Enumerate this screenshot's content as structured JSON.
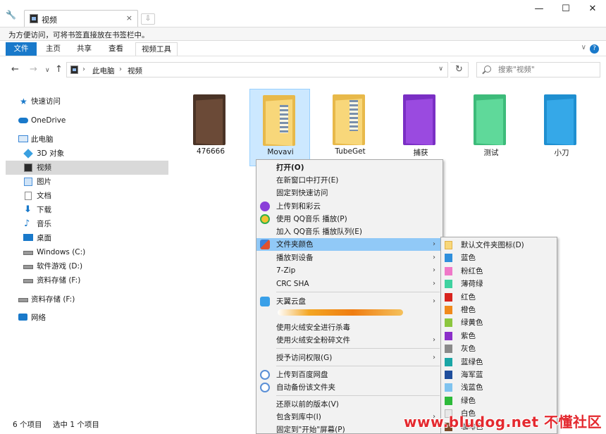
{
  "tab": {
    "title": "视频",
    "close": "×",
    "new_tab": "⇩"
  },
  "window": {
    "minimize": "—",
    "maximize": "☐",
    "close": "✕"
  },
  "bookmark_bar": {
    "hint": "为方便访问，可将书签直接放在书签栏中。"
  },
  "ribbon": {
    "file": "文件",
    "home": "主页",
    "share": "共享",
    "view": "查看",
    "video_tools": "视频工具",
    "expand": "∨",
    "help": "?"
  },
  "address": {
    "crumbs": [
      "此电脑",
      "视频"
    ],
    "sep": "›",
    "dropdown": "∨",
    "refresh": "↻"
  },
  "search": {
    "placeholder": "搜索\"视频\""
  },
  "sidebar": {
    "items": [
      {
        "label": "快速访问",
        "icon": "star-icon",
        "color": "#1979ca"
      },
      {
        "label": "OneDrive",
        "icon": "cloud-icon",
        "color": "#1979ca"
      },
      {
        "label": "此电脑",
        "icon": "computer-icon",
        "color": "#3a86d6"
      },
      {
        "label": "3D 对象",
        "icon": "cube-icon",
        "color": "#3aa0e0"
      },
      {
        "label": "视频",
        "icon": "video-icon",
        "color": "#2b2b2b"
      },
      {
        "label": "图片",
        "icon": "picture-icon",
        "color": "#4a90d9"
      },
      {
        "label": "文档",
        "icon": "document-icon",
        "color": "#8a8a8a"
      },
      {
        "label": "下载",
        "icon": "download-icon",
        "color": "#1979ca"
      },
      {
        "label": "音乐",
        "icon": "music-icon",
        "color": "#1979ca"
      },
      {
        "label": "桌面",
        "icon": "desktop-icon",
        "color": "#1979ca"
      },
      {
        "label": "Windows (C:)",
        "icon": "windows-drive-icon",
        "color": "#6b6b6b"
      },
      {
        "label": "软件游戏 (D:)",
        "icon": "drive-icon",
        "color": "#6b6b6b"
      },
      {
        "label": "资料存储 (F:)",
        "icon": "drive-icon",
        "color": "#6b6b6b"
      },
      {
        "label": "资料存储 (F:)",
        "icon": "drive-icon",
        "color": "#6b6b6b"
      },
      {
        "label": "网络",
        "icon": "network-icon",
        "color": "#1979ca"
      }
    ]
  },
  "files": [
    {
      "name": "476666",
      "back": "#4a3326",
      "front": "#6b4a37"
    },
    {
      "name": "Movavi",
      "back": "#e8b94a",
      "front": "#f8d77a"
    },
    {
      "name": "TubeGet",
      "back": "#e8b94a",
      "front": "#f8d77a"
    },
    {
      "name": "捕获",
      "back": "#7a2fc4",
      "front": "#9a4ae0"
    },
    {
      "name": "测试",
      "back": "#3dbb7a",
      "front": "#5fd99a"
    },
    {
      "name": "小刀",
      "back": "#1f8fd0",
      "front": "#35a8e8"
    }
  ],
  "status": {
    "count": "6 个项目",
    "selected": "选中 1 个项目"
  },
  "context_menu": {
    "items": [
      {
        "label": "打开(O)",
        "bold": true
      },
      {
        "label": "在新窗口中打开(E)"
      },
      {
        "label": "固定到快速访问"
      },
      {
        "label": "上传到和彩云",
        "icon": "cloud-upload-icon",
        "icon_color": "#8b3fd9"
      },
      {
        "label": "使用 QQ音乐 播放(P)",
        "icon": "qq-music-icon",
        "icon_color": "#f2c230"
      },
      {
        "label": "加入 QQ音乐 播放队列(E)"
      },
      {
        "label": "文件夹颜色",
        "icon": "paint-brush-icon",
        "icon_color": "#e0502e",
        "highlight": true,
        "arrow": "›"
      },
      {
        "label": "播放到设备",
        "arrow": "›"
      },
      {
        "label": "7-Zip",
        "arrow": "›"
      },
      {
        "label": "CRC SHA",
        "arrow": "›"
      },
      {
        "label": "天翼云盘",
        "icon": "cloud-drive-icon",
        "icon_color": "#3aa0e8",
        "arrow": "›"
      },
      {
        "label": "使用火绒安全进行杀毒"
      },
      {
        "label": "使用火绒安全粉碎文件",
        "arrow": "›"
      },
      {
        "label": "授予访问权限(G)",
        "arrow": "›"
      },
      {
        "label": "上传到百度网盘",
        "icon": "baidu-cloud-icon",
        "icon_color": "#5a8fd6"
      },
      {
        "label": "自动备份该文件夹",
        "icon": "baidu-backup-icon",
        "icon_color": "#5a8fd6"
      },
      {
        "label": "还原以前的版本(V)"
      },
      {
        "label": "包含到库中(I)",
        "arrow": "›"
      },
      {
        "label": "固定到\"开始\"屏幕(P)"
      }
    ]
  },
  "submenu": {
    "items": [
      {
        "label": "默认文件夹图标(D)",
        "color": "#f8d77a"
      },
      {
        "label": "蓝色",
        "color": "#2f8fdc"
      },
      {
        "label": "粉红色",
        "color": "#ef78c8"
      },
      {
        "label": "薄荷绿",
        "color": "#3fd2a0"
      },
      {
        "label": "红色",
        "color": "#d8241e"
      },
      {
        "label": "橙色",
        "color": "#f08a1c"
      },
      {
        "label": "绿黄色",
        "color": "#8cc63f"
      },
      {
        "label": "紫色",
        "color": "#8b2fc9"
      },
      {
        "label": "灰色",
        "color": "#8a8a8a"
      },
      {
        "label": "蓝绿色",
        "color": "#1aa6a6"
      },
      {
        "label": "海军蓝",
        "color": "#1f4e9c"
      },
      {
        "label": "浅蓝色",
        "color": "#7fc3ef"
      },
      {
        "label": "绿色",
        "color": "#2dba3a"
      },
      {
        "label": "白色",
        "color": "#e8e8e8"
      },
      {
        "label": "咖啡色",
        "color": "#7a4a2a"
      }
    ]
  },
  "watermark": "www.bludog.net 不懂社区"
}
